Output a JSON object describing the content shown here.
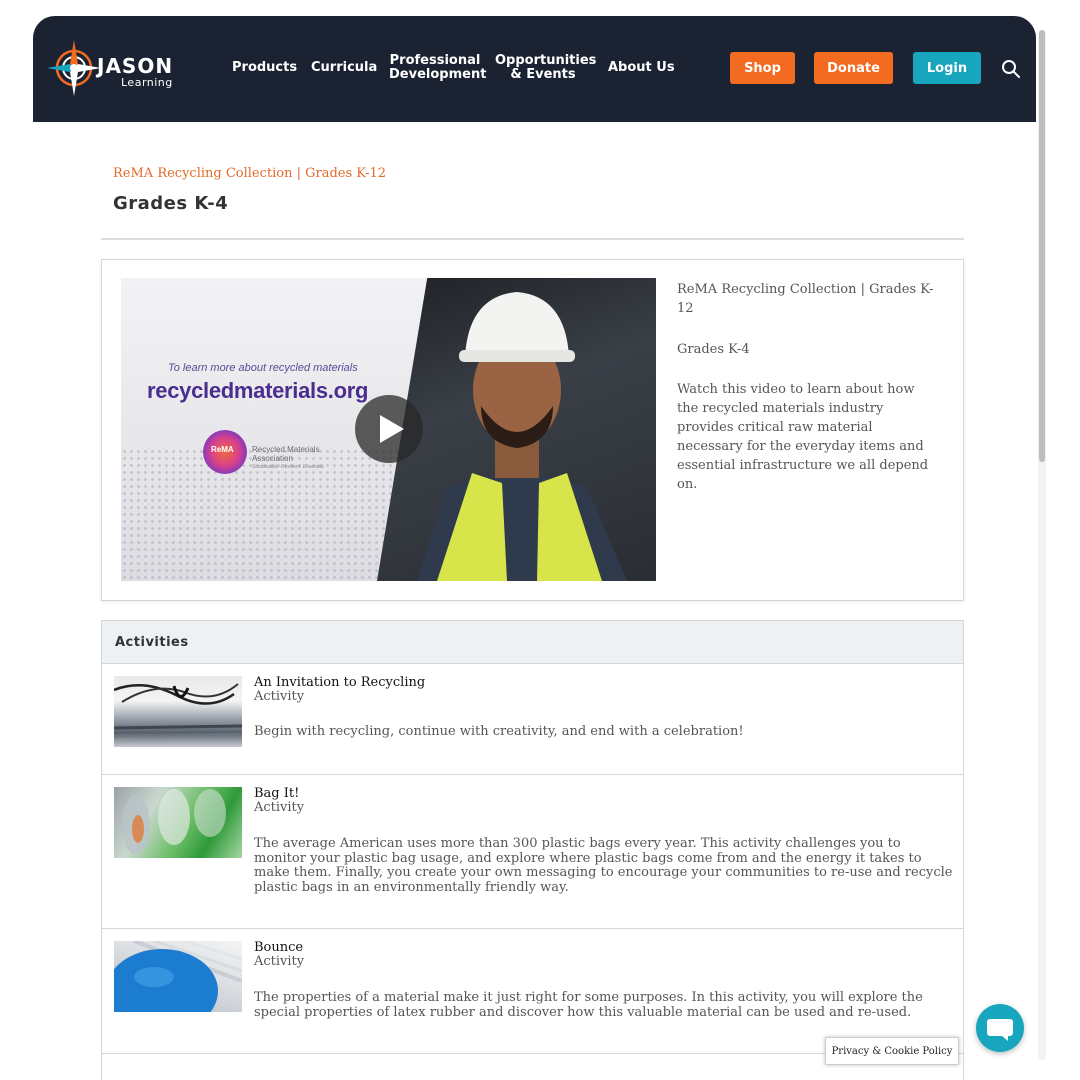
{
  "nav": {
    "logo_word": "JASON",
    "logo_sub": "Learning",
    "items": [
      "Products",
      "Curricula",
      "Professional Development",
      "Opportunities & Events",
      "About Us"
    ],
    "shop": "Shop",
    "donate": "Donate",
    "login": "Login",
    "colors": {
      "bg": "#1b2333",
      "orange": "#f36a21",
      "teal": "#17a6bd"
    }
  },
  "header": {
    "breadcrumb": "ReMA Recycling Collection | Grades K-12",
    "title": "Grades K-4"
  },
  "video": {
    "overlay_small": "To learn more about recycled materials",
    "overlay_big": "recycledmaterials.org",
    "org_logo": "ReMA",
    "org_name": "Recycled Materials Association",
    "org_tagline": "Sustainable. Resilient. Essential.",
    "collection": "ReMA Recycling Collection | Grades K-12",
    "grade": "Grades K-4",
    "description": "Watch this video to learn about how the recycled materials industry provides critical raw material necessary for the everyday items and essential infrastructure we all depend on."
  },
  "activities": {
    "heading": "Activities",
    "items": [
      {
        "title": "An Invitation to Recycling",
        "type": "Activity",
        "description": "Begin with recycling, continue with creativity, and end with a celebration!"
      },
      {
        "title": "Bag It!",
        "type": "Activity",
        "description": "The average American uses more than 300 plastic bags every year. This activity challenges you to monitor your plastic bag usage, and explore where plastic bags come from and the energy it takes to make them. Finally, you create your own messaging to encourage your communities to re-use and recycle plastic bags in an environmentally friendly way."
      },
      {
        "title": "Bounce",
        "type": "Activity",
        "description": "The properties of a material make it just right for some purposes. In this activity, you will explore the special properties of latex rubber and discover how this valuable material can be used and re-used."
      }
    ]
  },
  "privacy_label": "Privacy & Cookie Policy"
}
